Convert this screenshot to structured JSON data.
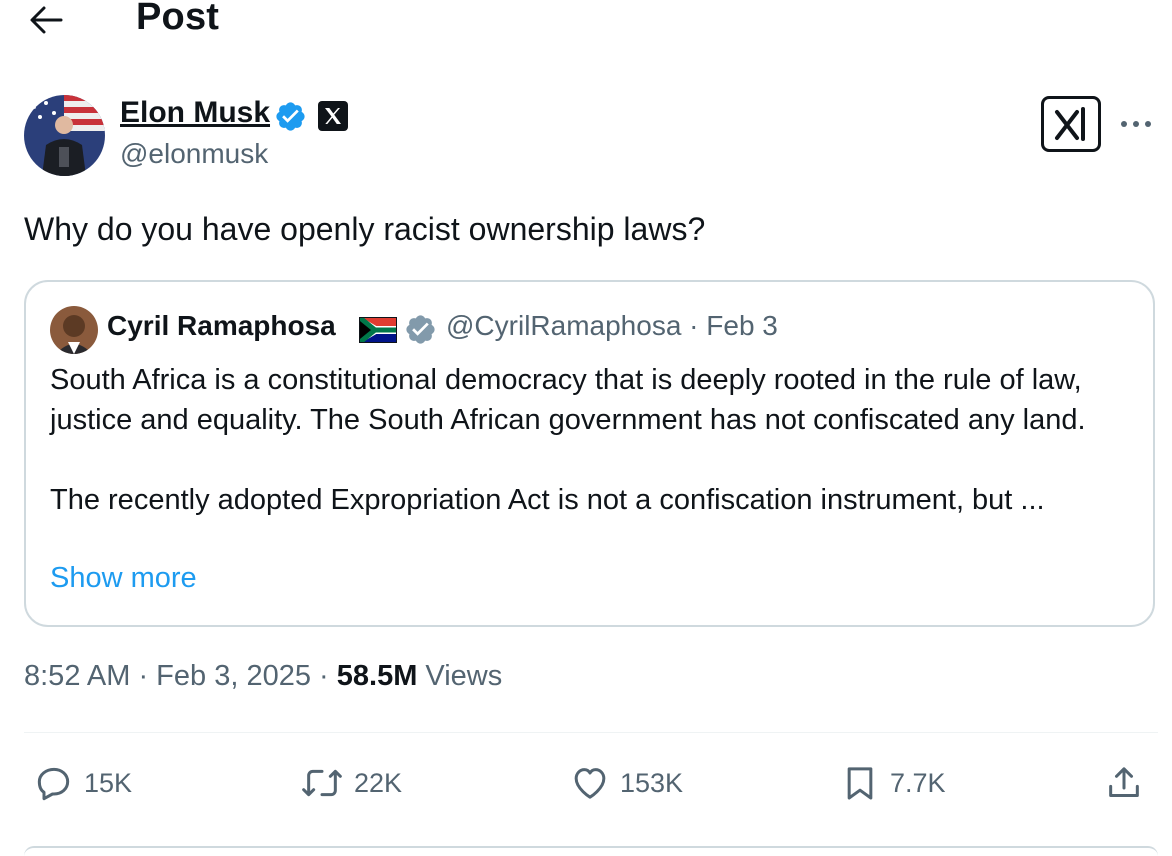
{
  "header": {
    "title": "Post"
  },
  "tweet": {
    "author": {
      "name": "Elon Musk",
      "handle": "@elonmusk"
    },
    "text": "Why do you have openly racist ownership laws?",
    "timestamp": "8:52 AM · Feb 3, 2025",
    "separator": " · ",
    "views_count": "58.5M",
    "views_label": "Views"
  },
  "quote": {
    "author_name": "Cyril Ramaphosa",
    "meta": "@CyrilRamaphosa · Feb 3",
    "paragraph1": "South Africa is a constitutional democracy that is deeply rooted in the rule of law, justice and equality. The South African government has not confiscated any land.",
    "paragraph2": "The recently adopted Expropriation Act is not a confiscation instrument, but ...",
    "show_more": "Show more"
  },
  "actions": {
    "replies": "15K",
    "reposts": "22K",
    "likes": "153K",
    "bookmarks": "7.7K"
  },
  "icons": {
    "back": "arrow-left-icon",
    "verified": "verified-badge-icon",
    "org": "x-logo-icon",
    "grok": "grok-icon",
    "more": "more-icon",
    "reply": "reply-icon",
    "repost": "repost-icon",
    "like": "heart-icon",
    "bookmark": "bookmark-icon",
    "share": "share-icon"
  },
  "colors": {
    "text": "#0f1419",
    "secondary": "#536471",
    "link": "#1d9bf0",
    "verified": "#1d9bf0",
    "quote_verified": "#829aab",
    "border": "#cfd9de"
  }
}
